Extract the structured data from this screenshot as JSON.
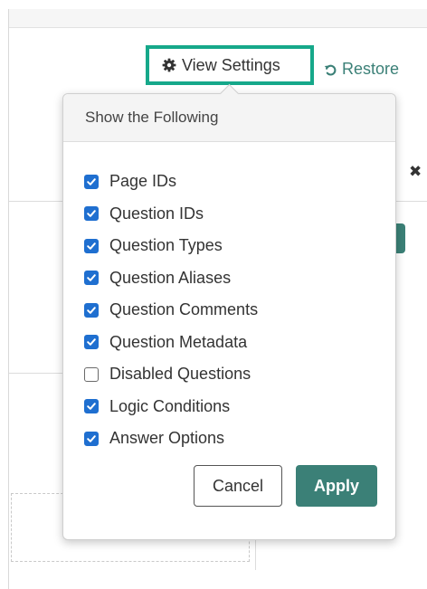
{
  "toolbar": {
    "view_settings_label": "View Settings",
    "view_settings_icon": "gear-icon",
    "restore_label": "Restore",
    "restore_icon": "undo-icon",
    "highlight_color": "#16a88a",
    "accent_color": "#3b8077"
  },
  "popover": {
    "title": "Show the Following",
    "options": [
      {
        "label": "Page IDs",
        "checked": true
      },
      {
        "label": "Question IDs",
        "checked": true
      },
      {
        "label": "Question Types",
        "checked": true
      },
      {
        "label": "Question Aliases",
        "checked": true
      },
      {
        "label": "Question Comments",
        "checked": true
      },
      {
        "label": "Question Metadata",
        "checked": true
      },
      {
        "label": "Disabled Questions",
        "checked": false
      },
      {
        "label": "Logic Conditions",
        "checked": true
      },
      {
        "label": "Answer Options",
        "checked": true
      }
    ],
    "cancel_label": "Cancel",
    "apply_label": "Apply",
    "checkbox_color": "#1f6fd0"
  },
  "background": {
    "close_icon": "close-icon"
  }
}
